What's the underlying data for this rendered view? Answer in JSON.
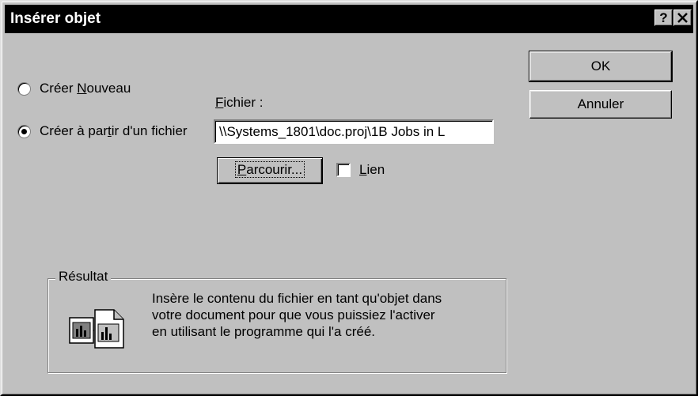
{
  "window": {
    "title": "Insérer objet",
    "help_label": "?",
    "close_label": "✕"
  },
  "options": {
    "create_new": {
      "prefix": "Créer ",
      "accel": "N",
      "suffix": "ouveau",
      "selected": false
    },
    "create_from_file": {
      "prefix": "Créer à par",
      "accel": "t",
      "suffix": "ir d'un fichier",
      "selected": true
    }
  },
  "file": {
    "label_accel": "F",
    "label_rest": "ichier :",
    "value": "\\\\Systems_1801\\doc.proj\\1B Jobs in L",
    "browse_accel": "P",
    "browse_rest": "arcourir...",
    "link_accel": "L",
    "link_rest": "ien",
    "link_checked": false
  },
  "buttons": {
    "ok": "OK",
    "cancel": "Annuler"
  },
  "result": {
    "title": "Résultat",
    "lines": [
      "Insère le contenu du fichier en tant qu'objet dans",
      "votre document pour que vous puissiez l'activer",
      "en utilisant le programme qui l'a créé."
    ],
    "icon": "document-object-icon"
  }
}
